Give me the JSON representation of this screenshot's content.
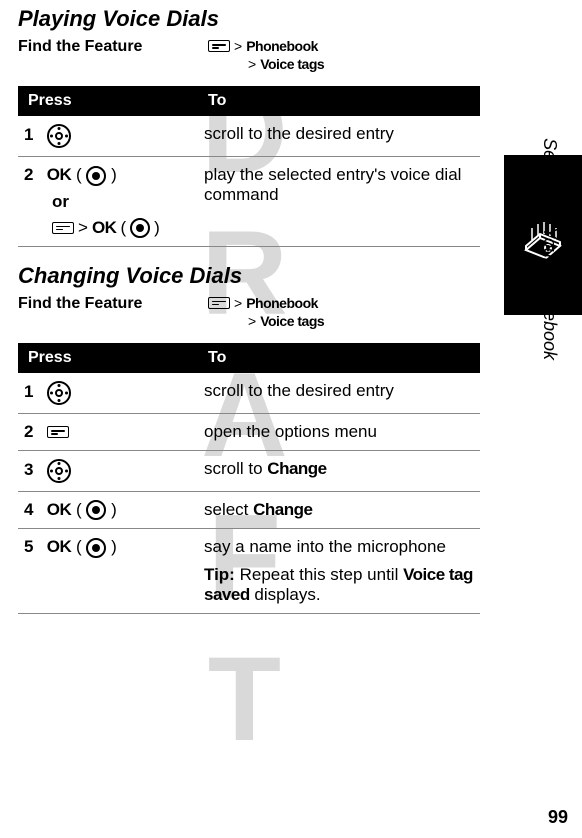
{
  "watermark": "DRAFT",
  "page_number": "99",
  "side_label": "Setting Up Your Phonebook",
  "section1": {
    "title": "Playing Voice Dials",
    "find_feature_label": "Find the Feature",
    "path_line1_gt": ">",
    "path_line1_item": "Phonebook",
    "path_line2_gt": ">",
    "path_line2_item": "Voice tags",
    "table_head_press": "Press",
    "table_head_to": "To",
    "row1_num": "1",
    "row1_to": "scroll to the desired entry",
    "row2_num": "2",
    "row2_ok": "OK",
    "row2_paren_open": "(",
    "row2_paren_close": ")",
    "row2_or": "or",
    "row2_gt": ">",
    "row2_ok2": "OK",
    "row2_to": "play the selected entry's voice dial command"
  },
  "section2": {
    "title": "Changing Voice Dials",
    "find_feature_label": "Find the Feature",
    "path_line1_gt": ">",
    "path_line1_item": "Phonebook",
    "path_line2_gt": ">",
    "path_line2_item": "Voice tags",
    "table_head_press": "Press",
    "table_head_to": "To",
    "row1_num": "1",
    "row1_to": "scroll to the desired entry",
    "row2_num": "2",
    "row2_to": "open the options menu",
    "row3_num": "3",
    "row3_to_pre": "scroll to ",
    "row3_to_bold": "Change",
    "row4_num": "4",
    "row4_ok": "OK",
    "row4_paren_open": "(",
    "row4_paren_close": ")",
    "row4_to_pre": "select ",
    "row4_to_bold": "Change",
    "row5_num": "5",
    "row5_ok": "OK",
    "row5_paren_open": "(",
    "row5_paren_close": ")",
    "row5_to": "say a name into the microphone",
    "row5_tip_label": "Tip:",
    "row5_tip_text_pre": " Repeat this step until ",
    "row5_tip_bold": "Voice tag saved",
    "row5_tip_text_post": " displays."
  }
}
